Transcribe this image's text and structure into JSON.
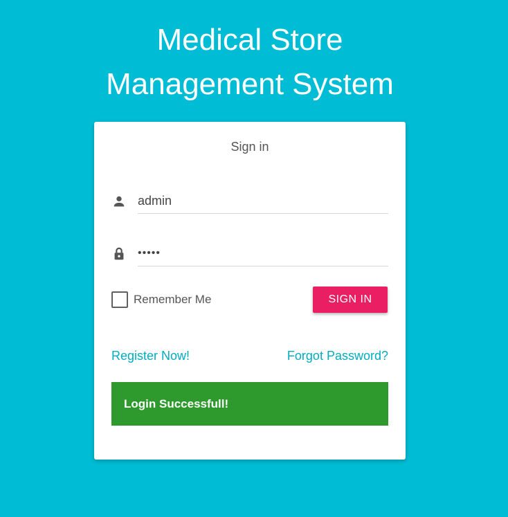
{
  "app": {
    "title_line1": "Medical Store",
    "title_line2": "Management System"
  },
  "form": {
    "title": "Sign in",
    "username": {
      "value": "admin",
      "icon": "person-icon"
    },
    "password": {
      "value": "•••••",
      "icon": "lock-icon"
    },
    "remember_label": "Remember Me",
    "remember_checked": false,
    "signin_label": "SIGN IN",
    "register_link": "Register Now!",
    "forgot_link": "Forgot Password?",
    "alert_message": "Login Successfull!"
  },
  "colors": {
    "background": "#00bcd4",
    "primary_button": "#e91e63",
    "link": "#00acc1",
    "success": "#2e9a2e"
  }
}
